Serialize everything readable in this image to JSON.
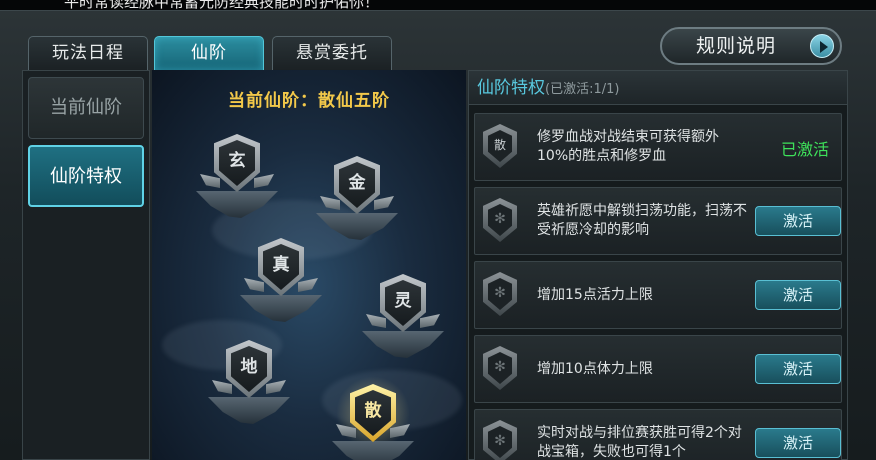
{
  "top_notice": "平时常读经脉中常蓄元防经典技能时时护佑你！",
  "tabs": [
    {
      "label": "玩法日程",
      "active": false
    },
    {
      "label": "仙阶",
      "active": true
    },
    {
      "label": "悬赏委托",
      "active": false
    }
  ],
  "rules_button": {
    "label": "规则说明",
    "icon": "arrow-right-circle-icon"
  },
  "side_menu": [
    {
      "label": "当前仙阶",
      "active": false
    },
    {
      "label": "仙阶特权",
      "active": true
    }
  ],
  "stage": {
    "title": "当前仙阶：散仙五阶",
    "ranks": [
      {
        "glyph": "玄",
        "current": false
      },
      {
        "glyph": "金",
        "current": false
      },
      {
        "glyph": "真",
        "current": false
      },
      {
        "glyph": "灵",
        "current": false
      },
      {
        "glyph": "地",
        "current": false
      },
      {
        "glyph": "散",
        "current": true
      }
    ]
  },
  "privileges": {
    "title": "仙阶特权",
    "count_text": "(已激活:1/1)",
    "items": [
      {
        "icon_glyph": "散",
        "text": "修罗血战对战结束可获得额外10%的胜点和修罗血",
        "status": "已激活",
        "activated": true
      },
      {
        "icon_glyph": "✻",
        "text": "英雄祈愿中解锁扫荡功能，扫荡不受祈愿冷却的影响",
        "button": "激活",
        "activated": false
      },
      {
        "icon_glyph": "✻",
        "text": "增加15点活力上限",
        "button": "激活",
        "activated": false
      },
      {
        "icon_glyph": "✻",
        "text": "增加10点体力上限",
        "button": "激活",
        "activated": false
      },
      {
        "icon_glyph": "✻",
        "text": "实时对战与排位赛获胜可得2个对战宝箱，失败也可得1个",
        "button": "激活",
        "activated": false
      }
    ]
  },
  "colors": {
    "accent_cyan": "#58c8de",
    "gold_title": "#f3c94a",
    "activated_green": "#3ee25a"
  }
}
